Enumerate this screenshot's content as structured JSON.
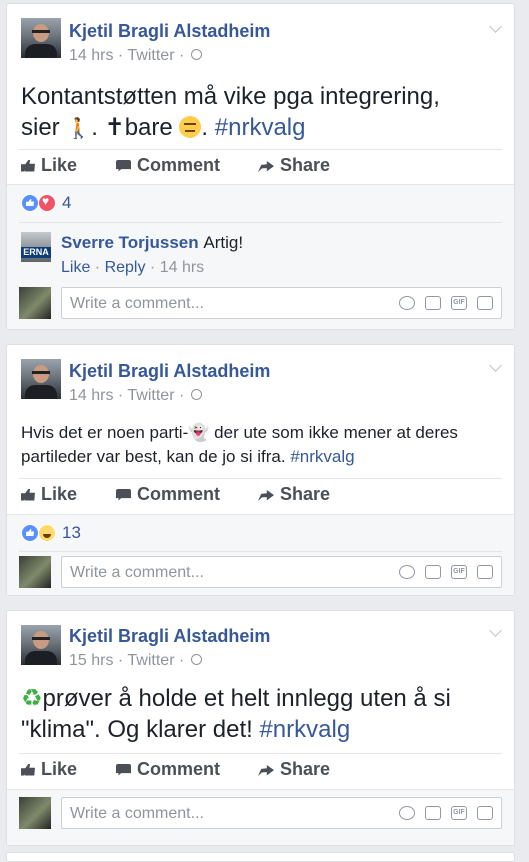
{
  "actions": {
    "like": "Like",
    "comment": "Comment",
    "share": "Share"
  },
  "composer": {
    "placeholder": "Write a comment..."
  },
  "posts": [
    {
      "author": "Kjetil Bragli Alstadheim",
      "meta": "14 hrs · Twitter ·",
      "text_parts": [
        "Kontantstøtten må vike pga integrering,",
        "sier",
        ".",
        "bare",
        ".",
        "#nrkvalg"
      ],
      "reaction_count": "4",
      "reactions": [
        "like",
        "love"
      ],
      "comments": [
        {
          "author": "Sverre Torjussen",
          "text": "Artig!",
          "avatar_label": "ERNA",
          "like": "Like",
          "reply": "Reply",
          "time": "14 hrs"
        }
      ]
    },
    {
      "author": "Kjetil Bragli Alstadheim",
      "meta": "14 hrs · Twitter ·",
      "text_parts": [
        "Hvis det er noen parti-",
        "der ute som ikke mener at deres",
        "partileder var best, kan de jo si ifra.",
        "#nrkvalg"
      ],
      "reaction_count": "13",
      "reactions": [
        "like",
        "haha"
      ]
    },
    {
      "author": "Kjetil Bragli Alstadheim",
      "meta": "15 hrs · Twitter ·",
      "text_parts": [
        "♻",
        "prøver å holde et helt innlegg uten å si",
        "\"klima\". Og klarer det!",
        "#nrkvalg"
      ]
    }
  ],
  "icons": [
    "like-icon",
    "comment-icon",
    "share-icon",
    "globe-icon",
    "chevron-down-icon",
    "smile-icon",
    "camera-icon",
    "gif-icon",
    "sticker-icon"
  ]
}
